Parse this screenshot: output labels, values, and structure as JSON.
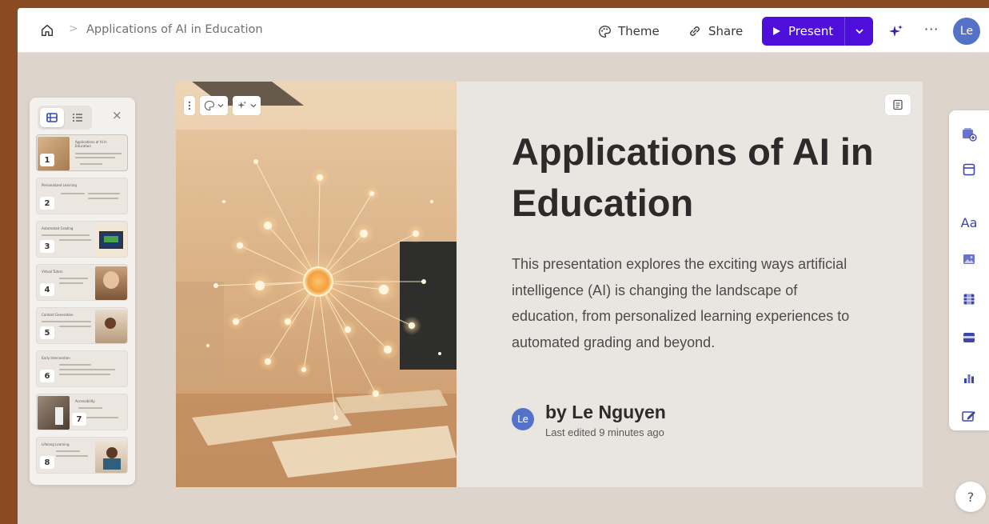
{
  "breadcrumb": {
    "title": "Applications of AI in Education",
    "separator": ">"
  },
  "toolbar": {
    "theme_label": "Theme",
    "share_label": "Share",
    "present_label": "Present",
    "more_label": "···",
    "avatar_initials": "Le",
    "accent_color": "#4d0fd9"
  },
  "thumbnails": [
    {
      "num": "1",
      "title": "Applications of AI in Education"
    },
    {
      "num": "2",
      "title": "Personalized Learning"
    },
    {
      "num": "3",
      "title": "Automated Grading"
    },
    {
      "num": "4",
      "title": "Virtual Tutors"
    },
    {
      "num": "5",
      "title": "Content Generation"
    },
    {
      "num": "6",
      "title": "Early Intervention"
    },
    {
      "num": "7",
      "title": "Accessibility"
    },
    {
      "num": "8",
      "title": "Lifelong Learning"
    }
  ],
  "slide": {
    "title": "Applications of AI in Education",
    "body": "This presentation explores the exciting ways artificial intelligence (AI) is changing the landscape of education, from personalized learning experiences to automated grading and beyond.",
    "author_initials": "Le",
    "author": "by Le Nguyen",
    "edited": "Last edited 9 minutes ago"
  },
  "panel": {
    "close_label": "×"
  },
  "help_label": "?",
  "icons": {
    "home": "home-icon",
    "theme": "palette-icon",
    "share": "link-icon",
    "present": "play-icon",
    "sparkle": "sparkle-icon",
    "notes": "notes-icon",
    "rail": [
      "add-card-icon",
      "layout-icon",
      "text-icon",
      "image-icon",
      "video-icon",
      "embed-icon",
      "chart-icon",
      "edit-icon"
    ]
  }
}
